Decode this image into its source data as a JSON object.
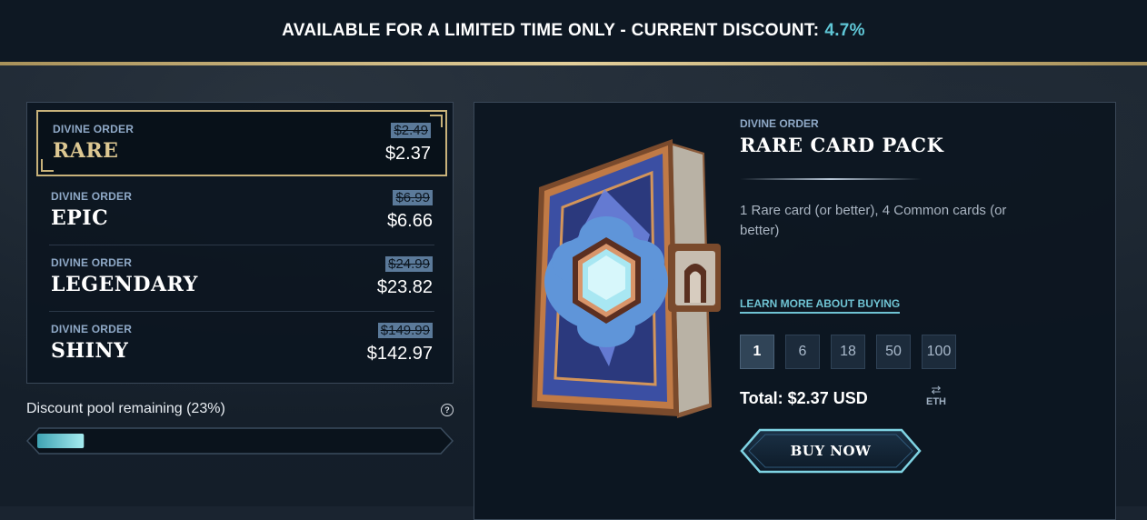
{
  "banner": {
    "text": "AVAILABLE FOR A LIMITED TIME ONLY - CURRENT DISCOUNT:",
    "discount": "4.7%"
  },
  "packs": [
    {
      "faction": "DIVINE ORDER",
      "rarity": "RARE",
      "old_price": "$2.49",
      "price": "$2.37",
      "selected": true
    },
    {
      "faction": "DIVINE ORDER",
      "rarity": "EPIC",
      "old_price": "$6.99",
      "price": "$6.66",
      "selected": false
    },
    {
      "faction": "DIVINE ORDER",
      "rarity": "LEGENDARY",
      "old_price": "$24.99",
      "price": "$23.82",
      "selected": false
    },
    {
      "faction": "DIVINE ORDER",
      "rarity": "SHINY",
      "old_price": "$149.99",
      "price": "$142.97",
      "selected": false
    }
  ],
  "pool": {
    "label": "Discount pool remaining (23%)",
    "remaining_fraction": 0.23,
    "help_icon": "question-circle-icon",
    "help_glyph": "?"
  },
  "detail": {
    "faction": "DIVINE ORDER",
    "title": "RARE CARD PACK",
    "description": "1 Rare card (or better), 4 Common cards (or better)",
    "learn_more": "LEARN MORE ABOUT BUYING",
    "quantities": [
      "1",
      "6",
      "18",
      "50",
      "100"
    ],
    "selected_quantity": "1",
    "total": "Total: $2.37 USD",
    "currency_toggle_icon": "swap-arrows-icon",
    "currency_toggle_glyph": "⇄",
    "currency_toggle_label": "ETH",
    "buy_label": "BUY NOW"
  },
  "colors": {
    "accent": "#5fc6d6",
    "gold": "#c8b27a",
    "panel": "#0c1620"
  }
}
